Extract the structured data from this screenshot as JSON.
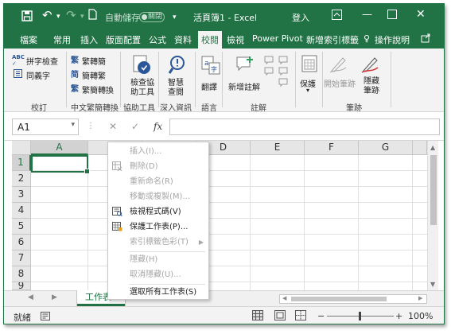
{
  "titlebar": {
    "autosave_label": "自動儲存",
    "autosave_state": "關閉",
    "doc_title": "活頁簿1 - Excel",
    "signin": "登入",
    "accent_color": "#217346"
  },
  "tabs": [
    "檔案",
    "常用",
    "插入",
    "版面配置",
    "公式",
    "資料",
    "校閱",
    "檢視",
    "Power Pivot",
    "新增索引標籤",
    "操作說明"
  ],
  "active_tab": "校閱",
  "ribbon": {
    "proofing": {
      "spell_check": "拼字檢查",
      "thesaurus": "同義字",
      "group": "校訂"
    },
    "chinese_conversion": {
      "to_traditional": "繁轉簡",
      "to_simplified": "簡轉繁",
      "conversion": "繁簡轉換",
      "group": "中文繁簡轉換"
    },
    "accessibility": {
      "check": "檢查協助工具",
      "group": "協助工具"
    },
    "insights": {
      "smart_lookup": "智慧查閱",
      "group": "深入資訊"
    },
    "language": {
      "translate": "翻譯",
      "group": "語言"
    },
    "comments": {
      "new_comment": "新增註解",
      "group": "註解"
    },
    "protect": {
      "protect": "保護"
    },
    "ink": {
      "start_inking": "開始筆跡",
      "hide_ink": "隱藏筆跡",
      "group": "筆跡"
    }
  },
  "formula_bar": {
    "name_box": "A1",
    "fx": "fx",
    "cancel": "✕",
    "enter": "✓"
  },
  "columns": [
    "A",
    "B",
    "C",
    "D",
    "E",
    "F",
    "G"
  ],
  "rows": [
    "1",
    "2",
    "3",
    "4",
    "5",
    "6",
    "7",
    "8",
    "9"
  ],
  "context_menu": [
    {
      "label": "插入(I)...",
      "enabled": false
    },
    {
      "label": "刪除(D)",
      "enabled": false
    },
    {
      "label": "重新命名(R)",
      "enabled": false
    },
    {
      "label": "移動或複製(M)...",
      "enabled": false
    },
    {
      "label": "檢視程式碼(V)",
      "enabled": true
    },
    {
      "label": "保護工作表(P)...",
      "enabled": true
    },
    {
      "label": "索引標籤色彩(T)",
      "enabled": false,
      "submenu": true
    },
    {
      "label": "隱藏(H)",
      "enabled": false
    },
    {
      "label": "取消隱藏(U)...",
      "enabled": false
    },
    {
      "label": "選取所有工作表(S)",
      "enabled": true
    }
  ],
  "sheet_tab": "工作表1",
  "status": {
    "ready": "就緒",
    "zoom": "100%",
    "zoom_out": "−",
    "zoom_in": "+"
  }
}
